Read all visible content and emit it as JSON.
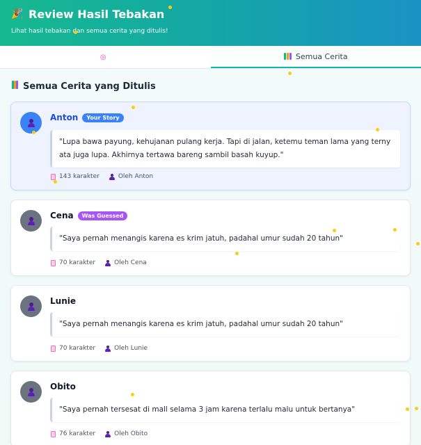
{
  "header": {
    "icon": "party-popper-icon",
    "title": "Review Hasil Tebakan",
    "subtitle": "Lihat hasil tebakan dan semua cerita yang ditulis!"
  },
  "tabs": [
    {
      "label": "",
      "icon": "target-icon",
      "active": false
    },
    {
      "label": "Semua Cerita",
      "icon": "books-icon",
      "active": true
    }
  ],
  "section": {
    "icon": "books-icon",
    "title": "Semua Cerita yang Ditulis"
  },
  "stories": [
    {
      "name": "Anton",
      "badge": "Your Story",
      "text": "\"Lupa bawa payung, kehujanan pulang kerja. Tapi di jalan, ketemu teman lama yang terny ata juga lupa. Akhirnya tertawa bareng sambil basah kuyup.\"",
      "chars": "143 karakter",
      "author": "Oleh Anton"
    },
    {
      "name": "Cena",
      "badge": "Was Guessed",
      "text": "\"Saya pernah menangis karena es krim jatuh, padahal umur sudah 20 tahun\"",
      "chars": "70 karakter",
      "author": "Oleh Cena"
    },
    {
      "name": "Lunie",
      "badge": "",
      "text": "\"Saya pernah menangis karena es krim jatuh, padahal umur sudah 20 tahun\"",
      "chars": "70 karakter",
      "author": "Oleh Lunie"
    },
    {
      "name": "Obito",
      "badge": "",
      "text": "\"Saya pernah tersesat di mall selama 3 jam karena terlalu malu untuk bertanya\"",
      "chars": "76 karakter",
      "author": "Oleh Obito"
    }
  ],
  "colors": {
    "header_start": "#16b98f",
    "header_end": "#1a92c4",
    "your_story_badge": "#3b82f6",
    "was_guessed_badge": "#a855f7",
    "confetti": "#facc15"
  }
}
